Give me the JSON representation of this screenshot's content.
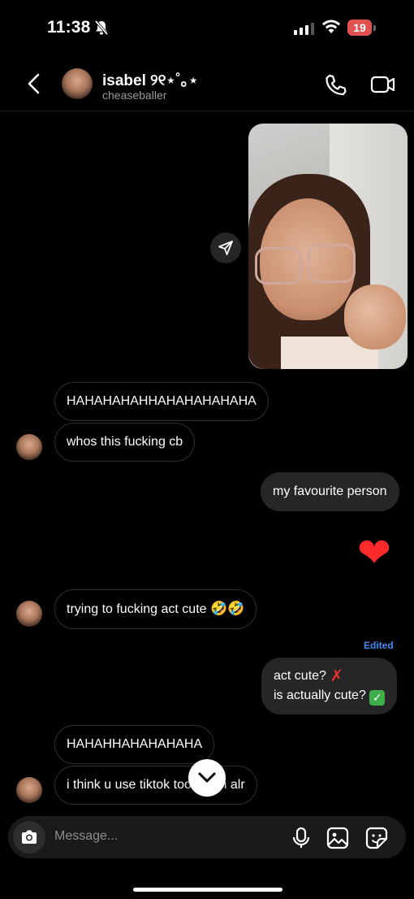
{
  "status": {
    "time": "11:38",
    "battery": "19"
  },
  "header": {
    "name": "isabel ୨୧⋆˚｡⋆",
    "username": "cheaseballer"
  },
  "messages": [
    {
      "text": "HAHAHAHAHHAHAHAHAHAHA"
    },
    {
      "text": "whos this fucking cb"
    },
    {
      "text": "my favourite person"
    },
    {
      "text": "❤"
    },
    {
      "text": "trying to fucking act cute",
      "emoji": "🤣🤣"
    },
    {
      "edited_label": "Edited",
      "line1": "act cute?",
      "line1_mark": "✗",
      "line2": "is actually cute?",
      "line2_mark": "✓"
    },
    {
      "text": "HAHAHHAHAHAHAHA"
    },
    {
      "text": "i think u use tiktok too much alr"
    }
  ],
  "composer": {
    "placeholder": "Message..."
  },
  "icons": {
    "accent": "#3d8df5",
    "heart_color": "#ff2a2a"
  }
}
